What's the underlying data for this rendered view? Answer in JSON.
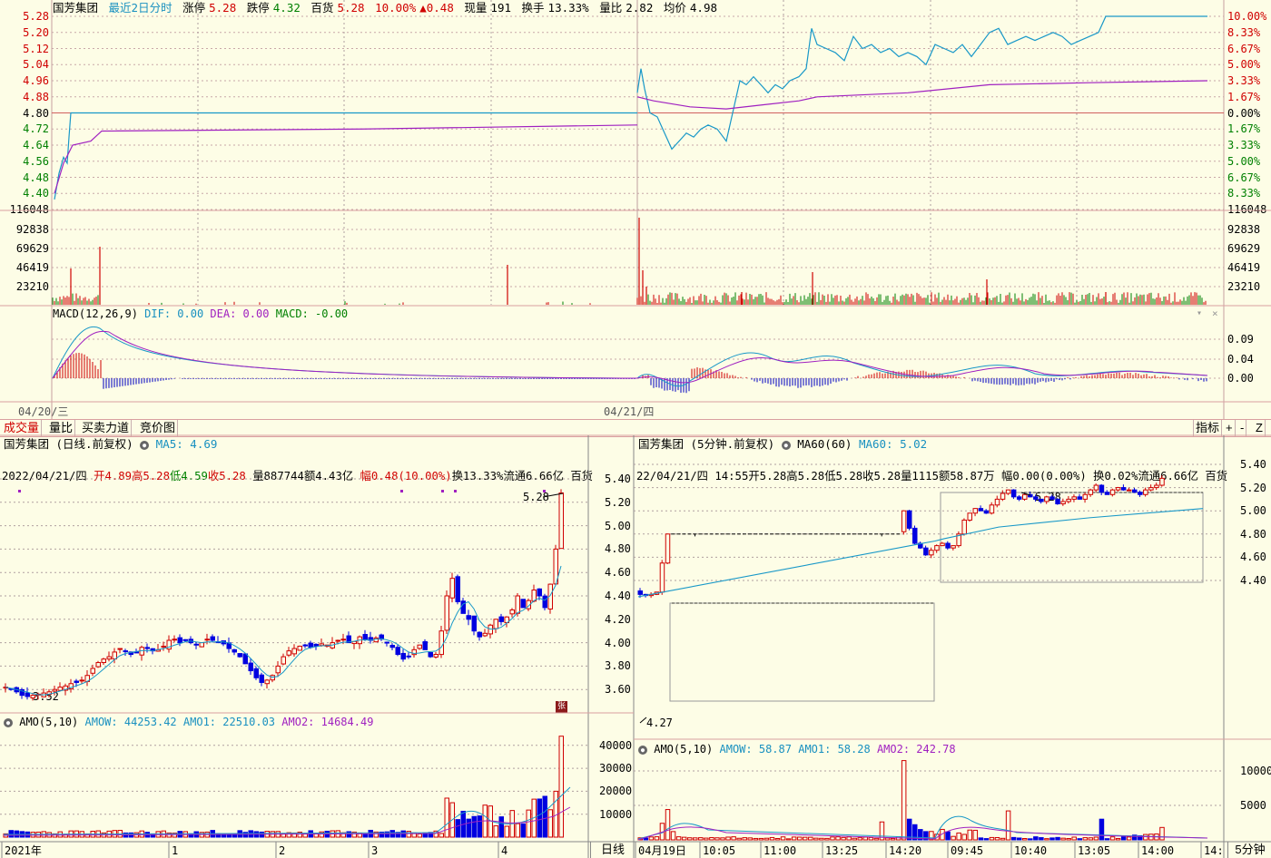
{
  "top_header": {
    "stock": "国芳集团",
    "period": "最近2日分时",
    "limit_up_label": "涨停",
    "limit_up": "5.28",
    "limit_down_label": "跌停",
    "limit_down": "4.32",
    "price_label": "百货",
    "price": "5.28",
    "pct": "10.00%",
    "change": "▲0.48",
    "vol_label": "现量",
    "vol": "191",
    "turnover_label": "换手",
    "turnover": "13.33%",
    "ratio_label": "量比",
    "ratio": "2.82",
    "avg_label": "均价",
    "avg": "4.98"
  },
  "intraday_left_axis": [
    "5.28",
    "5.20",
    "5.12",
    "5.04",
    "4.96",
    "4.88",
    "4.80",
    "4.72",
    "4.64",
    "4.56",
    "4.48",
    "4.40"
  ],
  "intraday_right_axis": [
    "10.00%",
    "8.33%",
    "6.67%",
    "5.00%",
    "3.33%",
    "1.67%",
    "0.00%",
    "1.67%",
    "3.33%",
    "5.00%",
    "6.67%",
    "8.33%"
  ],
  "volume_axis": [
    "116048",
    "92838",
    "69629",
    "46419",
    "23210"
  ],
  "macd": {
    "label": "MACD(12,26,9)",
    "dif": "DIF: 0.00",
    "dea": "DEA: 0.00",
    "macd": "MACD: -0.00",
    "axis": [
      "0.09",
      "0.04",
      "0.00"
    ]
  },
  "date_labels": [
    "04/20/三",
    "04/21/四"
  ],
  "tabs": [
    "成交量",
    "量比",
    "买卖力道",
    "竞价图"
  ],
  "tab_right": [
    "指标",
    "+",
    "-",
    "Z"
  ],
  "daily": {
    "title": "国芳集团 (日线.前复权)",
    "ma_label": "MA5: 4.69",
    "info_date": "2022/04/21/四",
    "info_open": "开4.89",
    "info_high": "高5.28",
    "info_low": "低4.59",
    "info_close": "收5.28",
    "info_vol": "量887744",
    "info_amt": "额4.43亿",
    "info_chg": "幅0.48(10.00%)",
    "info_turn": "换13.33%",
    "info_float": "流通6.66亿 百货",
    "axis": [
      "5.40",
      "5.20",
      "5.00",
      "4.80",
      "4.60",
      "4.40",
      "4.20",
      "4.00",
      "3.80",
      "3.60"
    ],
    "max_label": "5.28",
    "min_label": "3.52",
    "badge": "张",
    "amo_label": "AMO(5,10)",
    "amow": "AMOW: 44253.42",
    "amo1": "AMO1: 22510.03",
    "amo2": "AMO2: 14684.49",
    "amo_axis": [
      "40000",
      "30000",
      "20000",
      "10000"
    ],
    "x_labels": [
      "2021年",
      "1",
      "2",
      "3",
      "4"
    ],
    "footer_tab": "日线"
  },
  "min5": {
    "title": "国芳集团 (5分钟.前复权)",
    "ma_label": "MA60(60)",
    "ma_val": "MA60: 5.02",
    "info_date": "22/04/21/四",
    "info_time": "14:55",
    "info_open": "开5.28",
    "info_high": "高5.28",
    "info_low": "低5.28",
    "info_close": "收5.28",
    "info_vol": "量1115",
    "info_amt": "额58.87万",
    "info_chg": "幅0.00(0.00%)",
    "info_turn": "换0.02%",
    "info_float": "流通6.66亿 百货",
    "axis": [
      "5.40",
      "5.20",
      "5.00",
      "4.80",
      "4.60",
      "4.40"
    ],
    "max_label": "5.28",
    "min_label": "4.27",
    "amo_label": "AMO(5,10)",
    "amow": "AMOW: 58.87",
    "amo1": "AMO1: 58.28",
    "amo2": "AMO2: 242.78",
    "amo_axis": [
      "10000",
      "5000"
    ],
    "x_labels": [
      "04月19日",
      "10:05",
      "11:00",
      "13:25",
      "14:20",
      "09:45",
      "10:40",
      "13:05",
      "14:00",
      "14:"
    ],
    "footer_tab": "5分钟"
  },
  "colors": {
    "up": "#d00000",
    "down": "#0000e0",
    "price_line": "#1898c8",
    "avg_line": "#a020c0",
    "grid": "#c8a0a0"
  }
}
